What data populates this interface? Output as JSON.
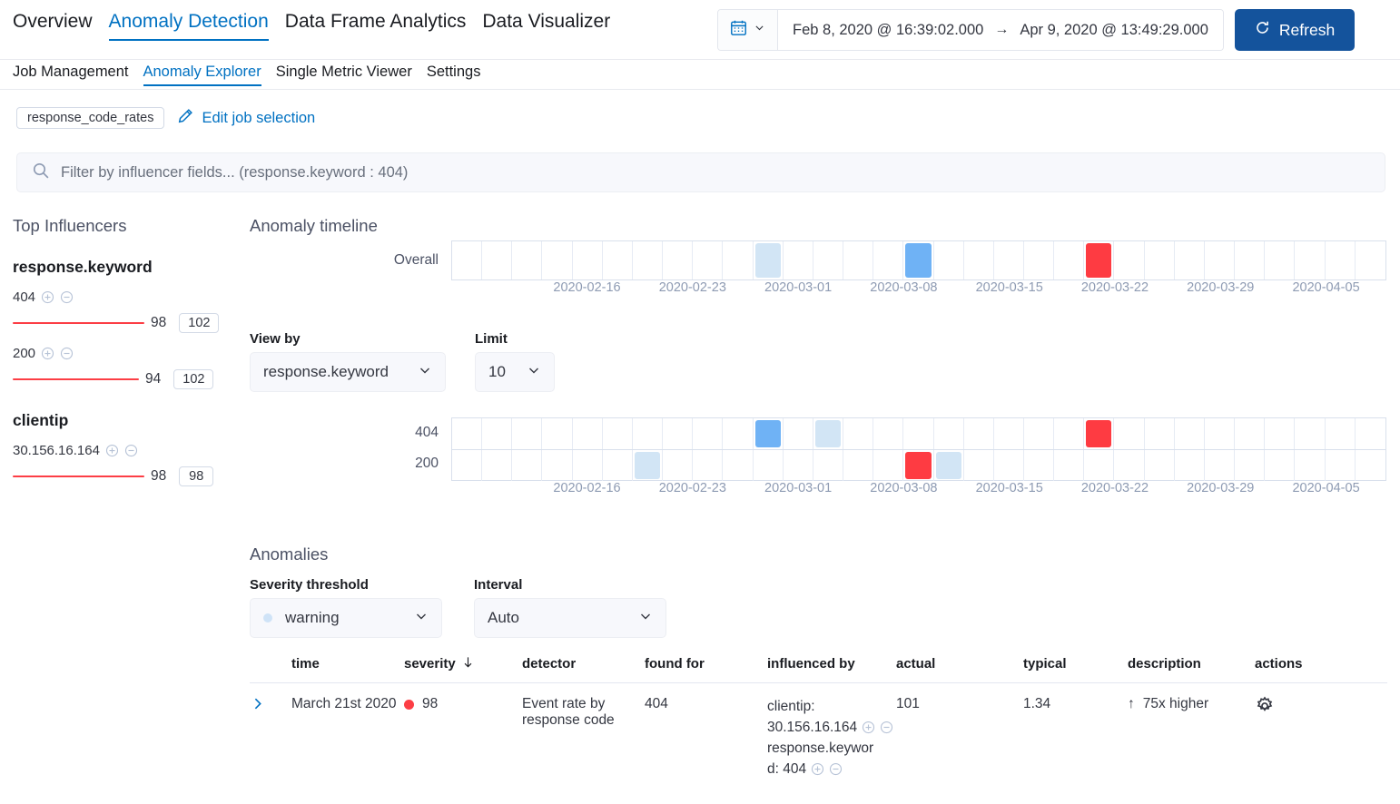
{
  "nav": {
    "primary": [
      {
        "label": "Overview",
        "active": false
      },
      {
        "label": "Anomaly Detection",
        "active": true
      },
      {
        "label": "Data Frame Analytics",
        "active": false
      },
      {
        "label": "Data Visualizer",
        "active": false
      }
    ],
    "secondary": [
      {
        "label": "Job Management",
        "active": false
      },
      {
        "label": "Anomaly Explorer",
        "active": true
      },
      {
        "label": "Single Metric Viewer",
        "active": false
      },
      {
        "label": "Settings",
        "active": false
      }
    ]
  },
  "datepicker": {
    "calendar_icon": "calendar-icon",
    "chevron_icon": "chevron-down-icon",
    "start": "Feb 8, 2020 @ 16:39:02.000",
    "arrow": "→",
    "end": "Apr 9, 2020 @ 13:49:29.000",
    "refresh_label": "Refresh",
    "refresh_icon": "refresh-icon",
    "refresh_color": "#14539c"
  },
  "jobrow": {
    "job_badge": "response_code_rates",
    "edit_label": "Edit job selection",
    "pencil_icon": "pencil-icon"
  },
  "filter": {
    "search_icon": "search-icon",
    "placeholder": "Filter by influencer fields... (response.keyword : 404)"
  },
  "influencers": {
    "title": "Top Influencers",
    "groups": [
      {
        "name": "response.keyword",
        "items": [
          {
            "label": "404",
            "score": "98",
            "total": "102",
            "bar_pct": 98
          },
          {
            "label": "200",
            "score": "94",
            "total": "102",
            "bar_pct": 94
          }
        ]
      },
      {
        "name": "clientip",
        "items": [
          {
            "label": "30.156.16.164",
            "score": "98",
            "total": "98",
            "bar_pct": 98
          }
        ]
      }
    ],
    "bar_color": "#fc3e45",
    "add_icon": "add-filter-icon",
    "remove_icon": "remove-filter-icon"
  },
  "timeline": {
    "title": "Anomaly timeline",
    "overall_label": "Overall",
    "cell_count": 31,
    "ticks": [
      "2020-02-16",
      "2020-02-23",
      "2020-03-01",
      "2020-03-08",
      "2020-03-15",
      "2020-03-22",
      "2020-03-29",
      "2020-04-05"
    ],
    "tick_positions": [
      4.5,
      8.0,
      11.5,
      15.0,
      18.5,
      22.0,
      25.5,
      29.0
    ],
    "overall_cells": [
      {
        "index": 10,
        "color": "#d2e5f5"
      },
      {
        "index": 15,
        "color": "#6fb2f5"
      },
      {
        "index": 21,
        "color": "#fe3b42"
      }
    ]
  },
  "viewby": {
    "view_by_label": "View by",
    "view_by_value": "response.keyword",
    "limit_label": "Limit",
    "limit_value": "10",
    "chevron_icon": "chevron-down-icon",
    "rows": [
      {
        "label": "404",
        "cells": [
          {
            "index": 10,
            "color": "#6fb2f5"
          },
          {
            "index": 12,
            "color": "#d2e5f5"
          },
          {
            "index": 21,
            "color": "#fe3b42"
          }
        ]
      },
      {
        "label": "200",
        "cells": [
          {
            "index": 6,
            "color": "#d2e5f5"
          },
          {
            "index": 15,
            "color": "#fe3b42"
          },
          {
            "index": 16,
            "color": "#d2e5f5"
          }
        ]
      }
    ],
    "ticks": [
      "2020-02-16",
      "2020-02-23",
      "2020-03-01",
      "2020-03-08",
      "2020-03-15",
      "2020-03-22",
      "2020-03-29",
      "2020-04-05"
    ],
    "tick_positions": [
      4.5,
      8.0,
      11.5,
      15.0,
      18.5,
      22.0,
      25.5,
      29.0
    ],
    "cell_count": 31
  },
  "anomalies": {
    "title": "Anomalies",
    "severity_label": "Severity threshold",
    "severity_value": "warning",
    "severity_dot_color": "#cfe3f7",
    "interval_label": "Interval",
    "interval_value": "Auto",
    "chevron_icon": "chevron-down-icon",
    "columns": [
      "time",
      "severity",
      "detector",
      "found for",
      "influenced by",
      "actual",
      "typical",
      "description",
      "actions"
    ],
    "sort_icon": "sort-desc-arrow-icon",
    "rows": [
      {
        "expand_icon": "chevron-right-icon",
        "time": "March 21st 2020",
        "severity": "98",
        "severity_dot_color": "#fc3e45",
        "detector": "Event rate by response code",
        "found_for": "404",
        "influenced_by": [
          {
            "name": "clientip:",
            "value": "30.156.16.164"
          },
          {
            "name": "response.keywor",
            "value": "d: 404"
          }
        ],
        "actual": "101",
        "typical": "1.34",
        "description": "75x higher",
        "description_arrow": "↑",
        "actions_icon": "gear-icon"
      }
    ]
  }
}
